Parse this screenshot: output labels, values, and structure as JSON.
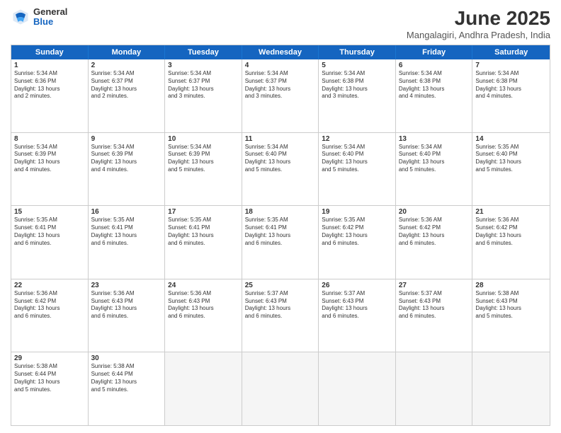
{
  "header": {
    "logo_general": "General",
    "logo_blue": "Blue",
    "title": "June 2025",
    "subtitle": "Mangalagiri, Andhra Pradesh, India"
  },
  "days": [
    "Sunday",
    "Monday",
    "Tuesday",
    "Wednesday",
    "Thursday",
    "Friday",
    "Saturday"
  ],
  "rows": [
    [
      {
        "day": "",
        "data": ""
      },
      {
        "day": "",
        "data": ""
      },
      {
        "day": "",
        "data": ""
      },
      {
        "day": "",
        "data": ""
      },
      {
        "day": "",
        "data": ""
      },
      {
        "day": "",
        "data": ""
      },
      {
        "day": "",
        "data": ""
      }
    ],
    [
      {
        "day": "1",
        "data": "Sunrise: 5:34 AM\nSunset: 6:36 PM\nDaylight: 13 hours\nand 2 minutes."
      },
      {
        "day": "2",
        "data": "Sunrise: 5:34 AM\nSunset: 6:37 PM\nDaylight: 13 hours\nand 2 minutes."
      },
      {
        "day": "3",
        "data": "Sunrise: 5:34 AM\nSunset: 6:37 PM\nDaylight: 13 hours\nand 3 minutes."
      },
      {
        "day": "4",
        "data": "Sunrise: 5:34 AM\nSunset: 6:37 PM\nDaylight: 13 hours\nand 3 minutes."
      },
      {
        "day": "5",
        "data": "Sunrise: 5:34 AM\nSunset: 6:38 PM\nDaylight: 13 hours\nand 3 minutes."
      },
      {
        "day": "6",
        "data": "Sunrise: 5:34 AM\nSunset: 6:38 PM\nDaylight: 13 hours\nand 4 minutes."
      },
      {
        "day": "7",
        "data": "Sunrise: 5:34 AM\nSunset: 6:38 PM\nDaylight: 13 hours\nand 4 minutes."
      }
    ],
    [
      {
        "day": "8",
        "data": "Sunrise: 5:34 AM\nSunset: 6:39 PM\nDaylight: 13 hours\nand 4 minutes."
      },
      {
        "day": "9",
        "data": "Sunrise: 5:34 AM\nSunset: 6:39 PM\nDaylight: 13 hours\nand 4 minutes."
      },
      {
        "day": "10",
        "data": "Sunrise: 5:34 AM\nSunset: 6:39 PM\nDaylight: 13 hours\nand 5 minutes."
      },
      {
        "day": "11",
        "data": "Sunrise: 5:34 AM\nSunset: 6:40 PM\nDaylight: 13 hours\nand 5 minutes."
      },
      {
        "day": "12",
        "data": "Sunrise: 5:34 AM\nSunset: 6:40 PM\nDaylight: 13 hours\nand 5 minutes."
      },
      {
        "day": "13",
        "data": "Sunrise: 5:34 AM\nSunset: 6:40 PM\nDaylight: 13 hours\nand 5 minutes."
      },
      {
        "day": "14",
        "data": "Sunrise: 5:35 AM\nSunset: 6:40 PM\nDaylight: 13 hours\nand 5 minutes."
      }
    ],
    [
      {
        "day": "15",
        "data": "Sunrise: 5:35 AM\nSunset: 6:41 PM\nDaylight: 13 hours\nand 6 minutes."
      },
      {
        "day": "16",
        "data": "Sunrise: 5:35 AM\nSunset: 6:41 PM\nDaylight: 13 hours\nand 6 minutes."
      },
      {
        "day": "17",
        "data": "Sunrise: 5:35 AM\nSunset: 6:41 PM\nDaylight: 13 hours\nand 6 minutes."
      },
      {
        "day": "18",
        "data": "Sunrise: 5:35 AM\nSunset: 6:41 PM\nDaylight: 13 hours\nand 6 minutes."
      },
      {
        "day": "19",
        "data": "Sunrise: 5:35 AM\nSunset: 6:42 PM\nDaylight: 13 hours\nand 6 minutes."
      },
      {
        "day": "20",
        "data": "Sunrise: 5:36 AM\nSunset: 6:42 PM\nDaylight: 13 hours\nand 6 minutes."
      },
      {
        "day": "21",
        "data": "Sunrise: 5:36 AM\nSunset: 6:42 PM\nDaylight: 13 hours\nand 6 minutes."
      }
    ],
    [
      {
        "day": "22",
        "data": "Sunrise: 5:36 AM\nSunset: 6:42 PM\nDaylight: 13 hours\nand 6 minutes."
      },
      {
        "day": "23",
        "data": "Sunrise: 5:36 AM\nSunset: 6:43 PM\nDaylight: 13 hours\nand 6 minutes."
      },
      {
        "day": "24",
        "data": "Sunrise: 5:36 AM\nSunset: 6:43 PM\nDaylight: 13 hours\nand 6 minutes."
      },
      {
        "day": "25",
        "data": "Sunrise: 5:37 AM\nSunset: 6:43 PM\nDaylight: 13 hours\nand 6 minutes."
      },
      {
        "day": "26",
        "data": "Sunrise: 5:37 AM\nSunset: 6:43 PM\nDaylight: 13 hours\nand 6 minutes."
      },
      {
        "day": "27",
        "data": "Sunrise: 5:37 AM\nSunset: 6:43 PM\nDaylight: 13 hours\nand 6 minutes."
      },
      {
        "day": "28",
        "data": "Sunrise: 5:38 AM\nSunset: 6:43 PM\nDaylight: 13 hours\nand 5 minutes."
      }
    ],
    [
      {
        "day": "29",
        "data": "Sunrise: 5:38 AM\nSunset: 6:44 PM\nDaylight: 13 hours\nand 5 minutes."
      },
      {
        "day": "30",
        "data": "Sunrise: 5:38 AM\nSunset: 6:44 PM\nDaylight: 13 hours\nand 5 minutes."
      },
      {
        "day": "",
        "data": ""
      },
      {
        "day": "",
        "data": ""
      },
      {
        "day": "",
        "data": ""
      },
      {
        "day": "",
        "data": ""
      },
      {
        "day": "",
        "data": ""
      }
    ]
  ]
}
